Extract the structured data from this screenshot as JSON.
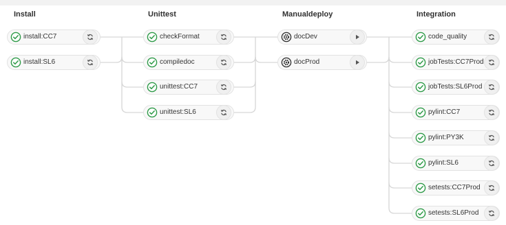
{
  "colors": {
    "success": "#2d9a47",
    "manual": "#333333",
    "connector": "#d6d6d6",
    "action_icon": "#555555"
  },
  "stages": [
    {
      "title": "Install",
      "jobs": [
        {
          "name": "install:CC7",
          "status": "success",
          "action": "retry-icon"
        },
        {
          "name": "install:SL6",
          "status": "success",
          "action": "retry-icon"
        }
      ]
    },
    {
      "title": "Unittest",
      "jobs": [
        {
          "name": "checkFormat",
          "status": "success",
          "action": "retry-icon"
        },
        {
          "name": "compiledoc",
          "status": "success",
          "action": "retry-icon"
        },
        {
          "name": "unittest:CC7",
          "status": "success",
          "action": "retry-icon"
        },
        {
          "name": "unittest:SL6",
          "status": "success",
          "action": "retry-icon"
        }
      ]
    },
    {
      "title": "Manualdeploy",
      "jobs": [
        {
          "name": "docDev",
          "status": "manual",
          "action": "play-icon"
        },
        {
          "name": "docProd",
          "status": "manual",
          "action": "play-icon"
        }
      ]
    },
    {
      "title": "Integration",
      "jobs": [
        {
          "name": "code_quality",
          "status": "success",
          "action": "retry-icon"
        },
        {
          "name": "jobTests:CC7Prod",
          "status": "success",
          "action": "retry-icon"
        },
        {
          "name": "jobTests:SL6Prod",
          "status": "success",
          "action": "retry-icon"
        },
        {
          "name": "pylint:CC7",
          "status": "success",
          "action": "retry-icon"
        },
        {
          "name": "pylint:PY3K",
          "status": "success",
          "action": "retry-icon"
        },
        {
          "name": "pylint:SL6",
          "status": "success",
          "action": "retry-icon"
        },
        {
          "name": "setests:CC7Prod",
          "status": "success",
          "action": "retry-icon"
        },
        {
          "name": "setests:SL6Prod",
          "status": "success",
          "action": "retry-icon"
        }
      ]
    }
  ]
}
